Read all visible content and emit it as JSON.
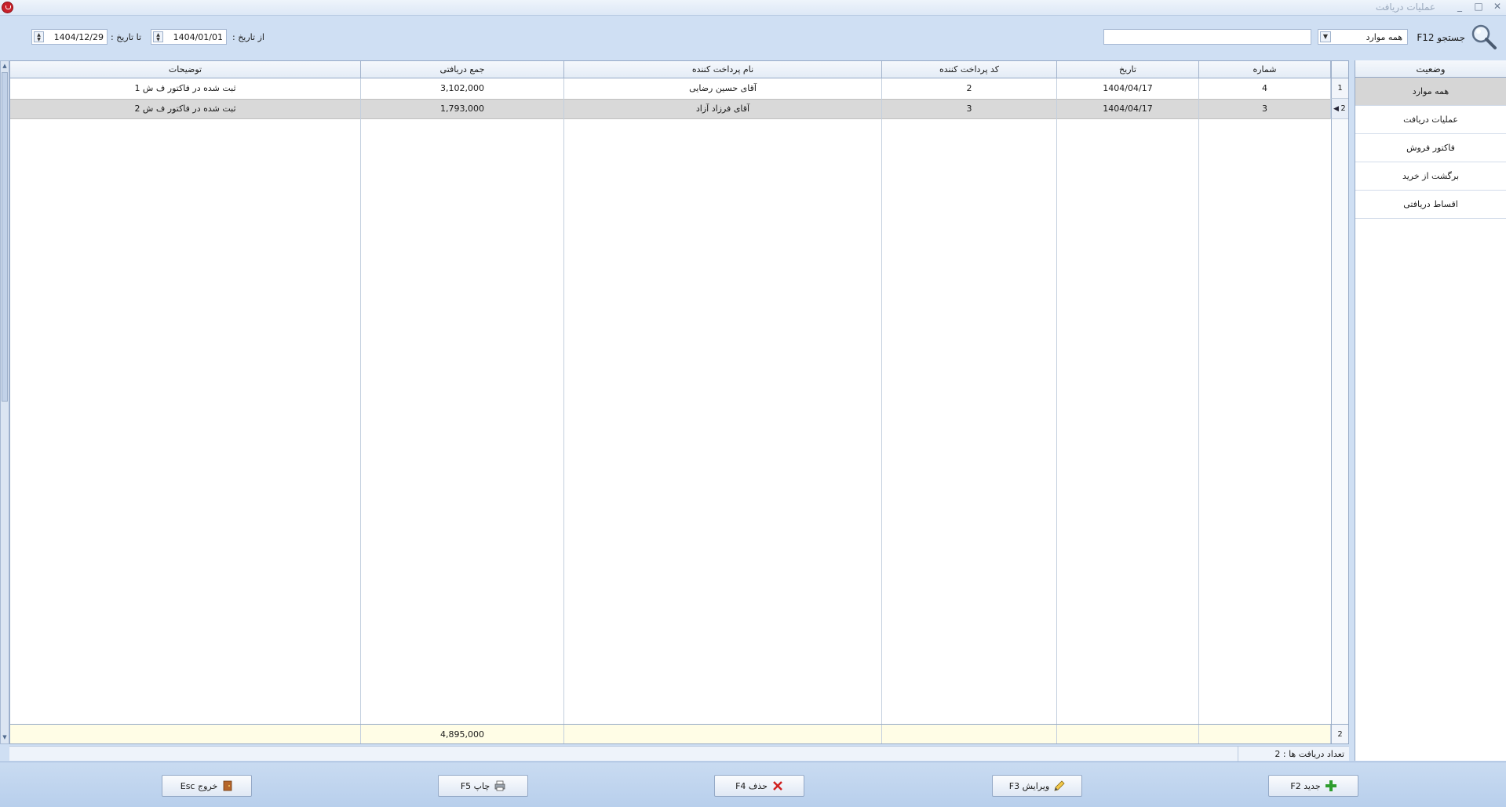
{
  "window": {
    "title": "عملیات دریافت",
    "controls": [
      "_",
      "□",
      "✕"
    ]
  },
  "toolbar": {
    "search_label": "جستجو F12",
    "filter_value": "همه موارد",
    "search_value": "",
    "from_date_label": "از تاریخ :",
    "from_date": "1404/01/01",
    "to_date_label": "تا تاریخ :",
    "to_date": "1404/12/29"
  },
  "grid": {
    "columns": [
      "شماره",
      "تاریخ",
      "کد پرداخت کننده",
      "نام پرداخت کننده",
      "جمع دریافتی",
      "توضیحات"
    ],
    "rows": [
      {
        "row_no": "1",
        "number": "4",
        "date": "1404/04/17",
        "payer_code": "2",
        "payer_name": "آقای حسین  رضایی",
        "total": "3,102,000",
        "desc": "ثبت شده در فاکتور ف ش 1"
      },
      {
        "row_no": "2",
        "number": "3",
        "date": "1404/04/17",
        "payer_code": "3",
        "payer_name": "آقای فرزاد  آزاد",
        "total": "1,793,000",
        "desc": "ثبت شده در فاکتور ف ش 2"
      }
    ],
    "footer_count": "2",
    "footer_total": "4,895,000"
  },
  "sidebar": {
    "title": "وضعیت",
    "items": [
      "همه موارد",
      "عملیات دریافت",
      "فاکتور فروش",
      "برگشت از خرید",
      "اقساط دریافتی"
    ],
    "active_index": 0
  },
  "status": {
    "count_text": "تعداد دریافت ها : 2"
  },
  "buttons": {
    "new": "جدید F2",
    "edit": "ویرایش F3",
    "delete": "حذف F4",
    "print": "چاپ F5",
    "exit": "خروج Esc"
  },
  "colors": {
    "background": "#cfdff3",
    "selected_row": "#d9d9d9",
    "footer": "#fffde6",
    "add_icon": "#2e9d2e",
    "delete_icon": "#d0201f"
  },
  "icons": {
    "app": "app-logo-icon",
    "search": "magnifier-icon",
    "new": "plus-icon",
    "edit": "pencil-icon",
    "delete": "x-icon",
    "print": "printer-icon",
    "exit": "door-icon"
  }
}
